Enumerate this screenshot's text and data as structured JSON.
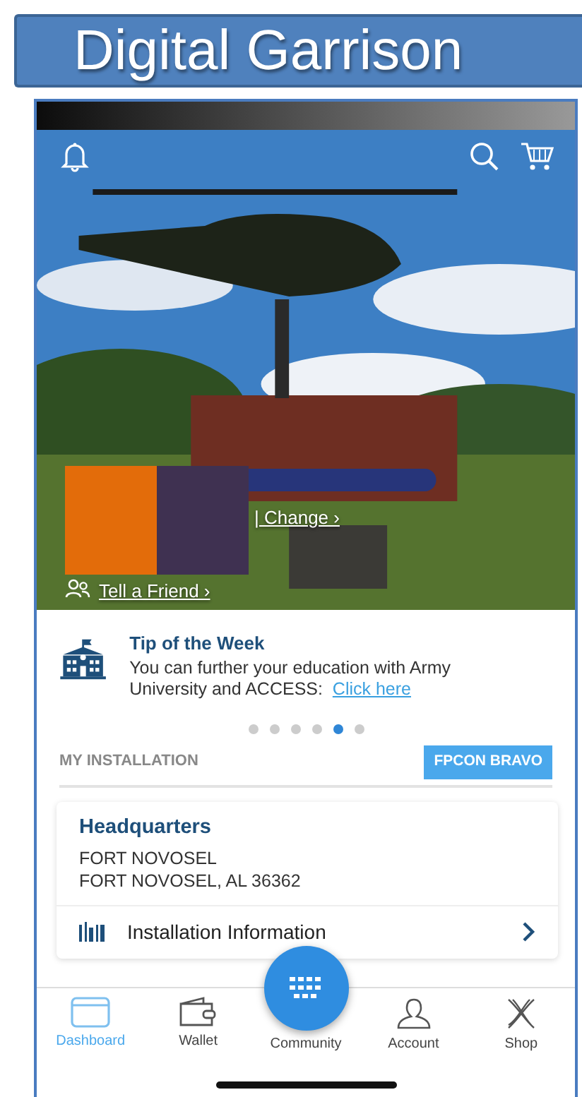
{
  "slide_title": "Digital Garrison",
  "hero": {
    "kind": "picture",
    "change_link": "| Change ›",
    "tell_friend_link": "Tell a Friend ›"
  },
  "tip": {
    "title": "Tip of the Week",
    "text": "You can further your education with Army University and ACCESS:",
    "link": "Click here",
    "pager": [
      {
        "selected": false
      },
      {
        "selected": false
      },
      {
        "selected": false
      },
      {
        "selected": false
      },
      {
        "selected": true
      },
      {
        "selected": false
      }
    ]
  },
  "installation": {
    "heading": "MY INSTALLATION",
    "fpcon": "FPCON BRAVO",
    "name": "Headquarters",
    "address_lines": [
      "FORT NOVOSEL",
      "FORT NOVOSEL, AL 36362"
    ],
    "link": "Installation Information"
  },
  "nav": [
    {
      "label": "Dashboard",
      "kind": "dashboard",
      "selected": true
    },
    {
      "label": "Wallet",
      "kind": "wallet",
      "selected": false
    },
    {
      "label": "Community",
      "kind": "community",
      "selected": false
    },
    {
      "label": "Account",
      "kind": "account",
      "selected": false
    },
    {
      "label": "Shop",
      "kind": "shop",
      "selected": false
    }
  ]
}
